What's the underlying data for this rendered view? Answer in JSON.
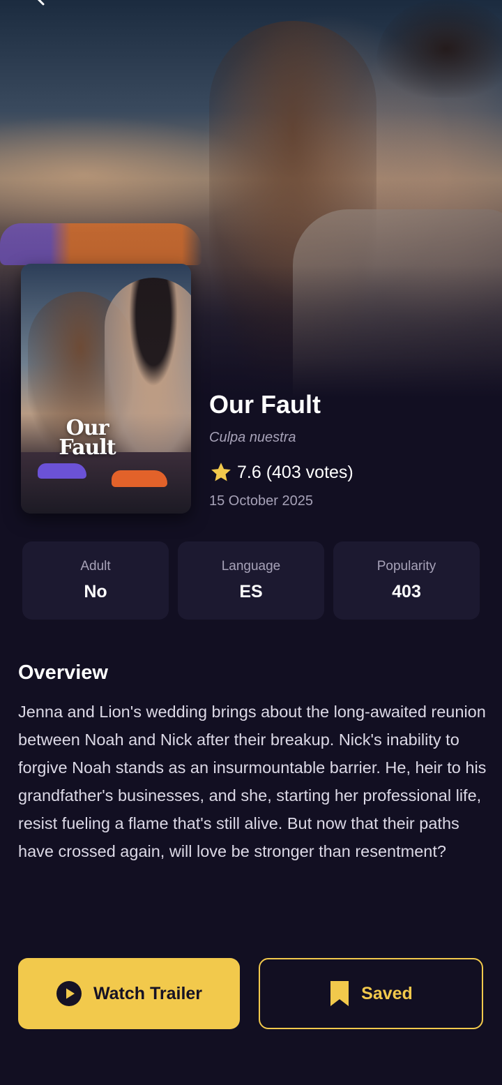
{
  "movie": {
    "title": "Our Fault",
    "original_title": "Culpa nuestra",
    "rating_text": "7.6 (403 votes)",
    "release_date": "15 October 2025",
    "poster_title_line1": "Our",
    "poster_title_line2": "Fault"
  },
  "stats": [
    {
      "label": "Adult",
      "value": "No"
    },
    {
      "label": "Language",
      "value": "ES"
    },
    {
      "label": "Popularity",
      "value": "403"
    }
  ],
  "overview": {
    "heading": "Overview",
    "text": "Jenna and Lion's wedding brings about the long-awaited reunion between Noah and Nick after their breakup. Nick's inability to forgive Noah stands as an insurmountable barrier. He, heir to his grandfather's businesses, and she, starting her professional life, resist fueling a flame that's still alive. But now that their paths have crossed again, will love be stronger than resentment?"
  },
  "actions": {
    "trailer_label": "Watch Trailer",
    "saved_label": "Saved"
  },
  "icons": {
    "back": "back-arrow-icon",
    "star": "star-icon",
    "play": "play-circle-icon",
    "bookmark": "bookmark-icon"
  },
  "colors": {
    "background": "#120f22",
    "card": "#1c1930",
    "accent": "#f2c94c",
    "muted_text": "#a7a2b8"
  }
}
